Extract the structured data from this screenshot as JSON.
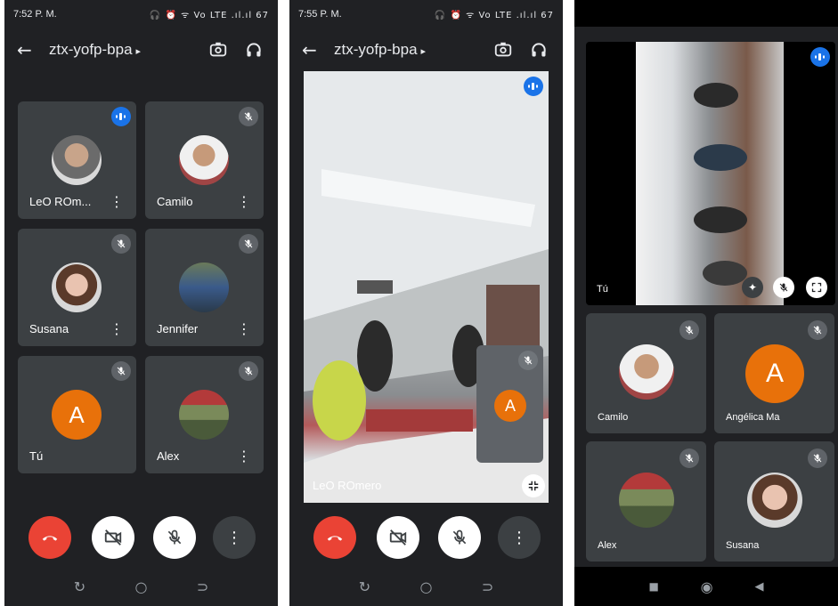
{
  "screens": [
    {
      "status_time": "7:52 P. M.",
      "status_icons": "🎧 ⏰ ᯤ Vo LTE .ıl.ıl 67",
      "meeting_code": "ztx-yofp-bpa",
      "tiles": [
        {
          "name": "LeO ROm...",
          "speaking": true,
          "avatar": "photo"
        },
        {
          "name": "Camilo",
          "muted": true,
          "avatar": "photo"
        },
        {
          "name": "Susana",
          "muted": true,
          "avatar": "photo"
        },
        {
          "name": "Jennifer",
          "muted": true,
          "avatar": "photo"
        },
        {
          "name": "Tú",
          "muted": true,
          "avatar_letter": "A"
        },
        {
          "name": "Alex",
          "muted": true,
          "avatar": "photo"
        }
      ]
    },
    {
      "status_time": "7:55 P. M.",
      "status_icons": "🎧 ⏰ ᯤ Vo LTE .ıl.ıl 67",
      "meeting_code": "ztx-yofp-bpa",
      "main_video_name": "LeO ROmero",
      "self_avatar_letter": "A"
    },
    {
      "top_video_name": "Tú",
      "tiles": [
        {
          "name": "Camilo",
          "muted": true,
          "avatar": "photo"
        },
        {
          "name": "Angélica Ma",
          "muted": true,
          "avatar_letter": "A"
        },
        {
          "name": "Alex",
          "muted": true,
          "avatar": "photo"
        },
        {
          "name": "Susana",
          "muted": true,
          "avatar": "photo"
        }
      ]
    }
  ],
  "icons": {
    "back": "arrow-back-icon",
    "switch_camera": "switch-camera-icon",
    "audio": "headphones-icon",
    "end_call": "end-call-icon",
    "camera_off": "camera-off-icon",
    "mic_off": "mic-off-icon",
    "more": "more-vert-icon"
  },
  "colors": {
    "background": "#202124",
    "tile": "#3c4043",
    "end_call": "#ea4335",
    "avatar_orange": "#e8710a",
    "speaking_blue": "#1a73e8"
  }
}
